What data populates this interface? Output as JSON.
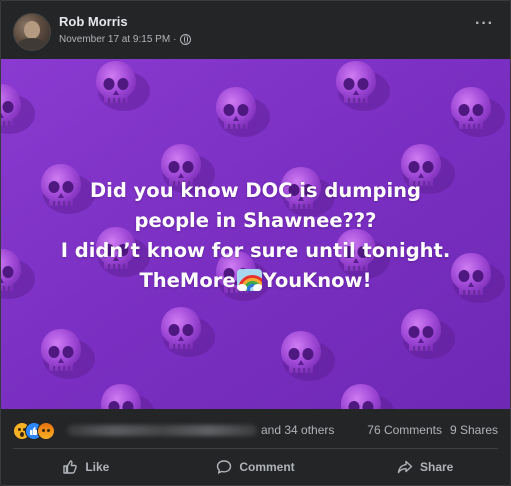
{
  "post": {
    "author": "Rob Morris",
    "timestamp": "November 17 at 9:15 PM",
    "separator": "·",
    "privacy_icon": "globe-icon",
    "more_label": "···"
  },
  "media": {
    "background_color": "#7a2fbf",
    "pattern_icon": "skull-icon",
    "line1": "Did you know DOC is dumping",
    "line2": "people in Shawnee???",
    "line3": "I didn’t know for sure until tonight.",
    "line4_before": "TheMore",
    "line4_emoji": "rainbow-emoji",
    "line4_after": "YouKnow!"
  },
  "stats": {
    "reactions": [
      "wow-reaction",
      "like-reaction",
      "angry-reaction"
    ],
    "others": "and 34 others",
    "comments": "76 Comments",
    "shares": "9 Shares"
  },
  "actions": {
    "like": "Like",
    "comment": "Comment",
    "share": "Share"
  },
  "colors": {
    "card": "#242526",
    "text_primary": "#e4e6eb",
    "text_secondary": "#b0b3b8",
    "accent_like": "#2d88ff"
  }
}
